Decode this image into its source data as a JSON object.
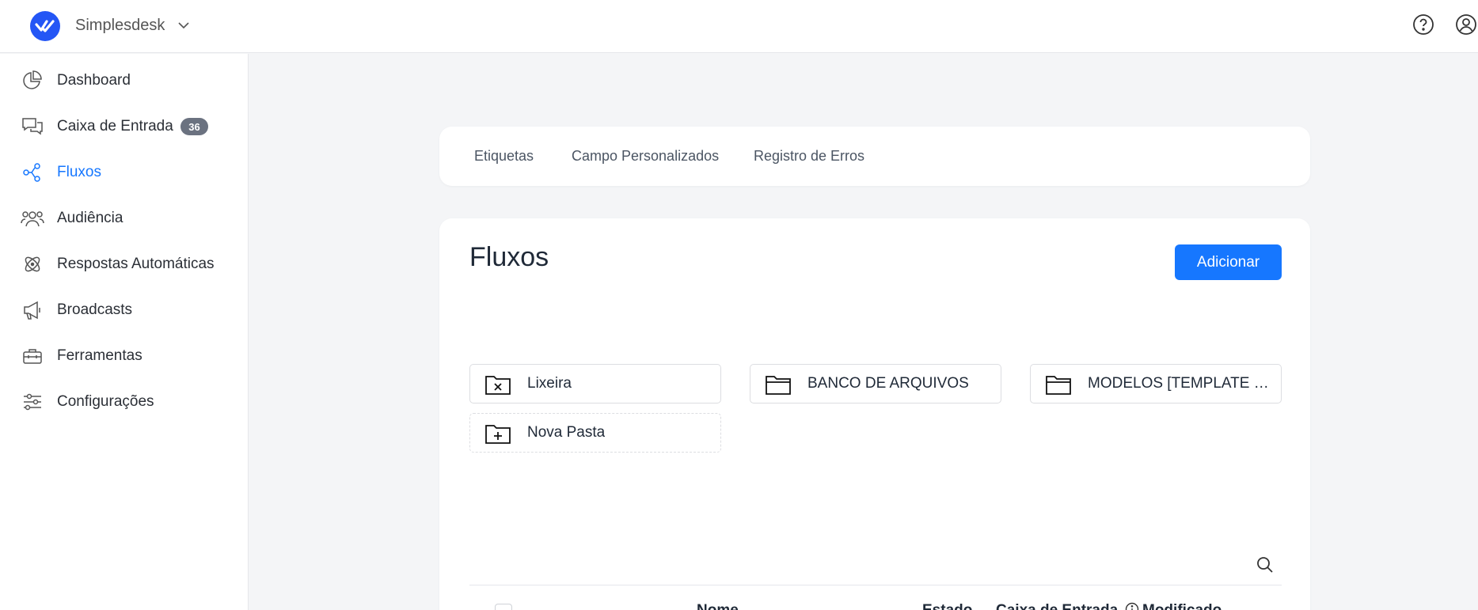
{
  "header": {
    "workspace_name": "Simplesdesk",
    "icons": [
      "logo-icon",
      "chevron-down-icon",
      "help-icon",
      "user-icon"
    ]
  },
  "sidebar": {
    "items": [
      {
        "label": "Dashboard",
        "icon": "pie-chart-icon"
      },
      {
        "label": "Caixa de Entrada",
        "icon": "chat-bubbles-icon",
        "badge": "36"
      },
      {
        "label": "Fluxos",
        "icon": "flow-nodes-icon",
        "active": true
      },
      {
        "label": "Audiência",
        "icon": "people-icon"
      },
      {
        "label": "Respostas Automáticas",
        "icon": "atom-icon"
      },
      {
        "label": "Broadcasts",
        "icon": "megaphone-icon"
      },
      {
        "label": "Ferramentas",
        "icon": "toolbox-icon"
      },
      {
        "label": "Configurações",
        "icon": "sliders-icon"
      }
    ]
  },
  "tabs": [
    "Etiquetas",
    "Campo Personalizados",
    "Registro de Erros"
  ],
  "main": {
    "title": "Fluxos",
    "add_button": "Adicionar",
    "folders": [
      {
        "label": "Lixeira",
        "icon": "trash-folder-icon"
      },
      {
        "label": "BANCO DE ARQUIVOS",
        "icon": "folder-icon"
      },
      {
        "label": "MODELOS [TEMPLATE S...",
        "icon": "folder-icon"
      },
      {
        "label": "Nova Pasta",
        "icon": "folder-plus-icon"
      }
    ],
    "table_headers": [
      "Nome",
      "Estado",
      "Caixa de Entrada",
      "Modificado"
    ]
  },
  "colors": {
    "accent": "#1677ff",
    "logo": "#2456f5",
    "badge": "#6b7280"
  }
}
